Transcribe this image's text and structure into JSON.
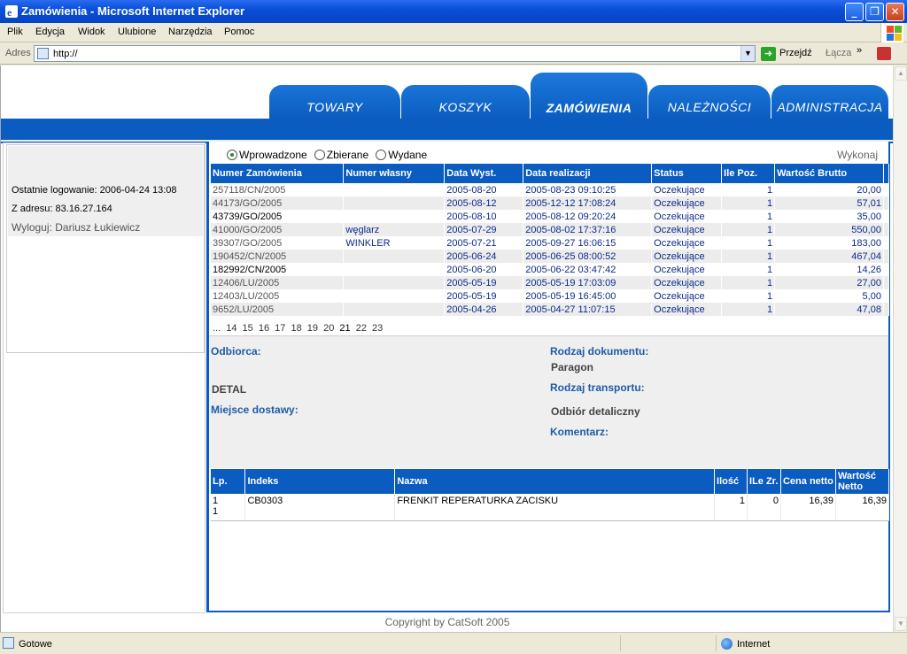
{
  "window": {
    "title": "Zamówienia - Microsoft Internet Explorer",
    "min": "_",
    "max": "❐",
    "close": "✕"
  },
  "menu": [
    "Plik",
    "Edycja",
    "Widok",
    "Ulubione",
    "Narzędzia",
    "Pomoc"
  ],
  "address": {
    "label": "Adres",
    "url": "http://",
    "go": "Przejdź",
    "links": "Łącza",
    "chevron": "»"
  },
  "tabs": [
    "TOWARY",
    "KOSZYK",
    "ZAMÓWIENIA",
    "NALEŻNOŚCI",
    "ADMINISTRACJA"
  ],
  "active_tab": "ZAMÓWIENIA",
  "login": {
    "last": "Ostatnie logowanie: 2006-04-24 13:08",
    "from": "Z adresu: 83.16.27.164",
    "logout": "Wyloguj: Dariusz Łukiewicz"
  },
  "filters": {
    "options": [
      "Wprowadzone",
      "Zbierane",
      "Wydane"
    ],
    "selected": "Wprowadzone",
    "run": "Wykonaj"
  },
  "orders": {
    "headers": [
      "Numer Zamówienia",
      "Numer własny",
      "Data Wyst.",
      "Data realizacji",
      "Status",
      "Ile Poz.",
      "Wartość Brutto"
    ],
    "rows": [
      [
        "257118/CN/2005",
        "",
        "2005-08-20",
        "2005-08-23 09:10:25",
        "Oczekujące",
        "1",
        "20,00"
      ],
      [
        "44173/GO/2005",
        "",
        "2005-08-12",
        "2005-12-12 17:08:24",
        "Oczekujące",
        "1",
        "57,01"
      ],
      [
        "43739/GO/2005",
        "",
        "2005-08-10",
        "2005-08-12 09:20:24",
        "Oczekujące",
        "1",
        "35,00"
      ],
      [
        "41000/GO/2005",
        "węglarz",
        "2005-07-29",
        "2005-08-02 17:37:16",
        "Oczekujące",
        "1",
        "550,00"
      ],
      [
        "39307/GO/2005",
        "WINKLER",
        "2005-07-21",
        "2005-09-27 16:06:15",
        "Oczekujące",
        "1",
        "183,00"
      ],
      [
        "190452/CN/2005",
        "",
        "2005-06-24",
        "2005-06-25 08:00:52",
        "Oczekujące",
        "1",
        "467,04"
      ],
      [
        "182992/CN/2005",
        "",
        "2005-06-20",
        "2005-06-22 03:47:42",
        "Oczekujące",
        "1",
        "14,26"
      ],
      [
        "12406/LU/2005",
        "",
        "2005-05-19",
        "2005-05-19 17:03:09",
        "Oczekujące",
        "1",
        "27,00"
      ],
      [
        "12403/LU/2005",
        "",
        "2005-05-19",
        "2005-05-19 16:45:00",
        "Oczekujące",
        "1",
        "5,00"
      ],
      [
        "9652/LU/2005",
        "",
        "2005-04-26",
        "2005-04-27 11:07:15",
        "Oczekujące",
        "1",
        "47,08"
      ]
    ]
  },
  "pager": {
    "ellipsis": "...",
    "pages": [
      "14",
      "15",
      "16",
      "17",
      "18",
      "19",
      "20",
      "21",
      "22",
      "23"
    ],
    "current": "21"
  },
  "details": {
    "odbiorca_label": "Odbiorca:",
    "odbiorca_value": "DETAL",
    "miejsce_label": "Miejsce dostawy:",
    "rodzaj_dok_label": "Rodzaj dokumentu:",
    "rodzaj_dok_value": "Paragon",
    "rodzaj_trans_label": "Rodzaj transportu:",
    "rodzaj_trans_value": "Odbiór detaliczny",
    "komentarz_label": "Komentarz:"
  },
  "items": {
    "headers": [
      "Lp.",
      "Indeks",
      "Nazwa",
      "Ilość",
      "ILe Zr.",
      "Cena netto",
      "Wartość Netto"
    ],
    "rows": [
      [
        "1\n1",
        "CB0303",
        "FRENKIT REPERATURKA ZACISKU",
        "1",
        "0",
        "16,39",
        "16,39"
      ]
    ]
  },
  "copyright": "Copyright by CatSoft 2005",
  "statusbar": {
    "left": "Gotowe",
    "zone": "Internet"
  }
}
